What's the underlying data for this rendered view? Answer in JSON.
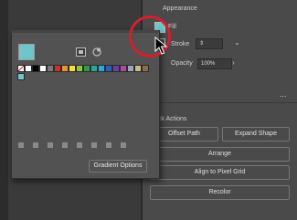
{
  "appearance": {
    "title": "Appearance",
    "fill_label": "Fill",
    "fill_color": "#6ec6c9",
    "stroke_label": "Stroke",
    "opacity_label": "Opacity",
    "opacity_value": "100%"
  },
  "quick_actions": {
    "title": "Quick Actions",
    "offset_path": "Offset Path",
    "expand_shape": "Expand Shape",
    "arrange": "Arrange",
    "align_to_pixel_grid": "Align to Pixel Grid",
    "recolor": "Recolor"
  },
  "swatches_panel": {
    "gradient_options": "Gradient Options",
    "more_options": "..."
  },
  "colors": {
    "accent_fill": "#6ec6c9",
    "highlight": "#d3202b",
    "panel_bg": "#4a4a4a",
    "popover_bg": "#525252"
  }
}
